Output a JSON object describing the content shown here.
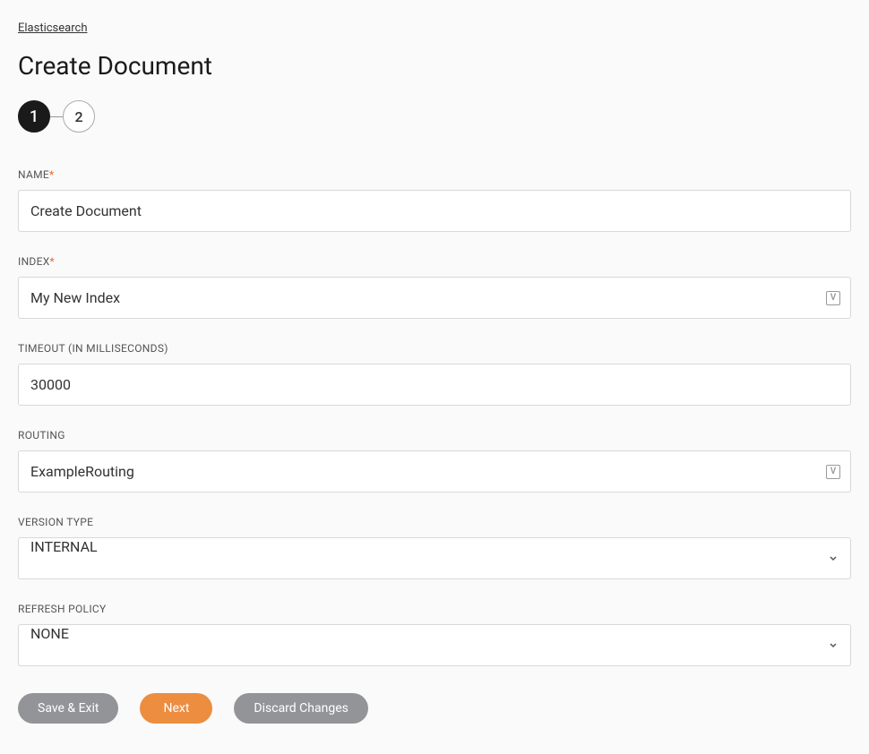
{
  "breadcrumb": {
    "label": "Elasticsearch"
  },
  "page": {
    "title": "Create Document"
  },
  "stepper": {
    "step1": "1",
    "step2": "2"
  },
  "form": {
    "name": {
      "label": "NAME",
      "value": "Create Document"
    },
    "index": {
      "label": "INDEX",
      "value": "My New Index"
    },
    "timeout": {
      "label": "TIMEOUT (IN MILLISECONDS)",
      "value": "30000"
    },
    "routing": {
      "label": "ROUTING",
      "value": "ExampleRouting"
    },
    "versionType": {
      "label": "VERSION TYPE",
      "value": "INTERNAL"
    },
    "refreshPolicy": {
      "label": "REFRESH POLICY",
      "value": "NONE"
    }
  },
  "buttons": {
    "saveExit": "Save & Exit",
    "next": "Next",
    "discard": "Discard Changes"
  },
  "icons": {
    "variable": "V"
  }
}
